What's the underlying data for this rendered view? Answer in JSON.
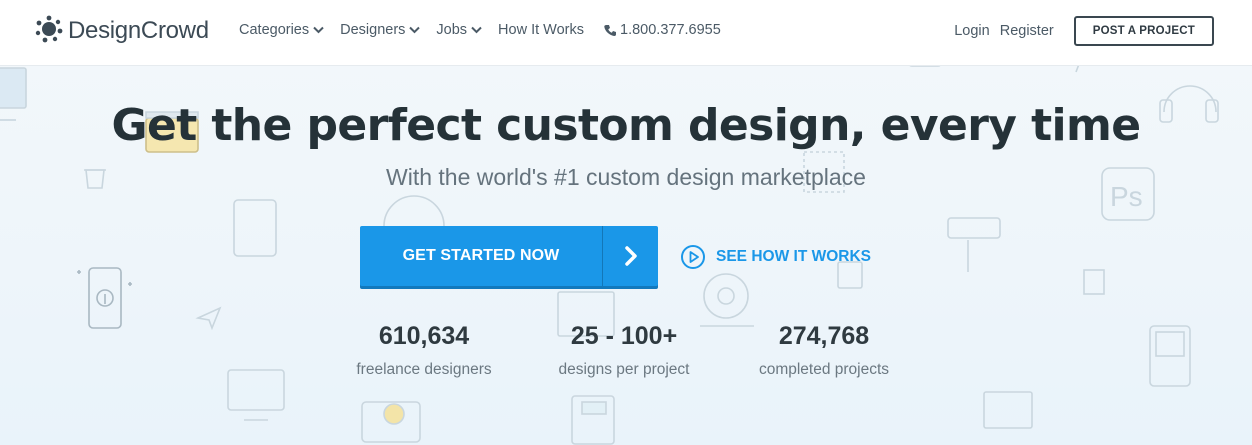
{
  "brand": {
    "name": "DesignCrowd"
  },
  "nav": {
    "items": [
      {
        "label": "Categories",
        "has_dropdown": true
      },
      {
        "label": "Designers",
        "has_dropdown": true
      },
      {
        "label": "Jobs",
        "has_dropdown": true
      },
      {
        "label": "How It Works",
        "has_dropdown": false
      }
    ],
    "phone": "1.800.377.6955",
    "login": "Login",
    "register": "Register",
    "post_project": "POST A PROJECT"
  },
  "hero": {
    "headline": "Get the perfect custom design, every time",
    "subheadline": "With the world's #1 custom design marketplace",
    "cta_primary": "GET STARTED NOW",
    "cta_secondary": "SEE HOW IT WORKS",
    "stats": [
      {
        "value": "610,634",
        "label": "freelance designers"
      },
      {
        "value": "25 - 100+",
        "label": "designs per project"
      },
      {
        "value": "274,768",
        "label": "completed projects"
      }
    ]
  },
  "colors": {
    "accent": "#1a97e8",
    "text_dark": "#253238",
    "text_muted": "#6b7881"
  }
}
